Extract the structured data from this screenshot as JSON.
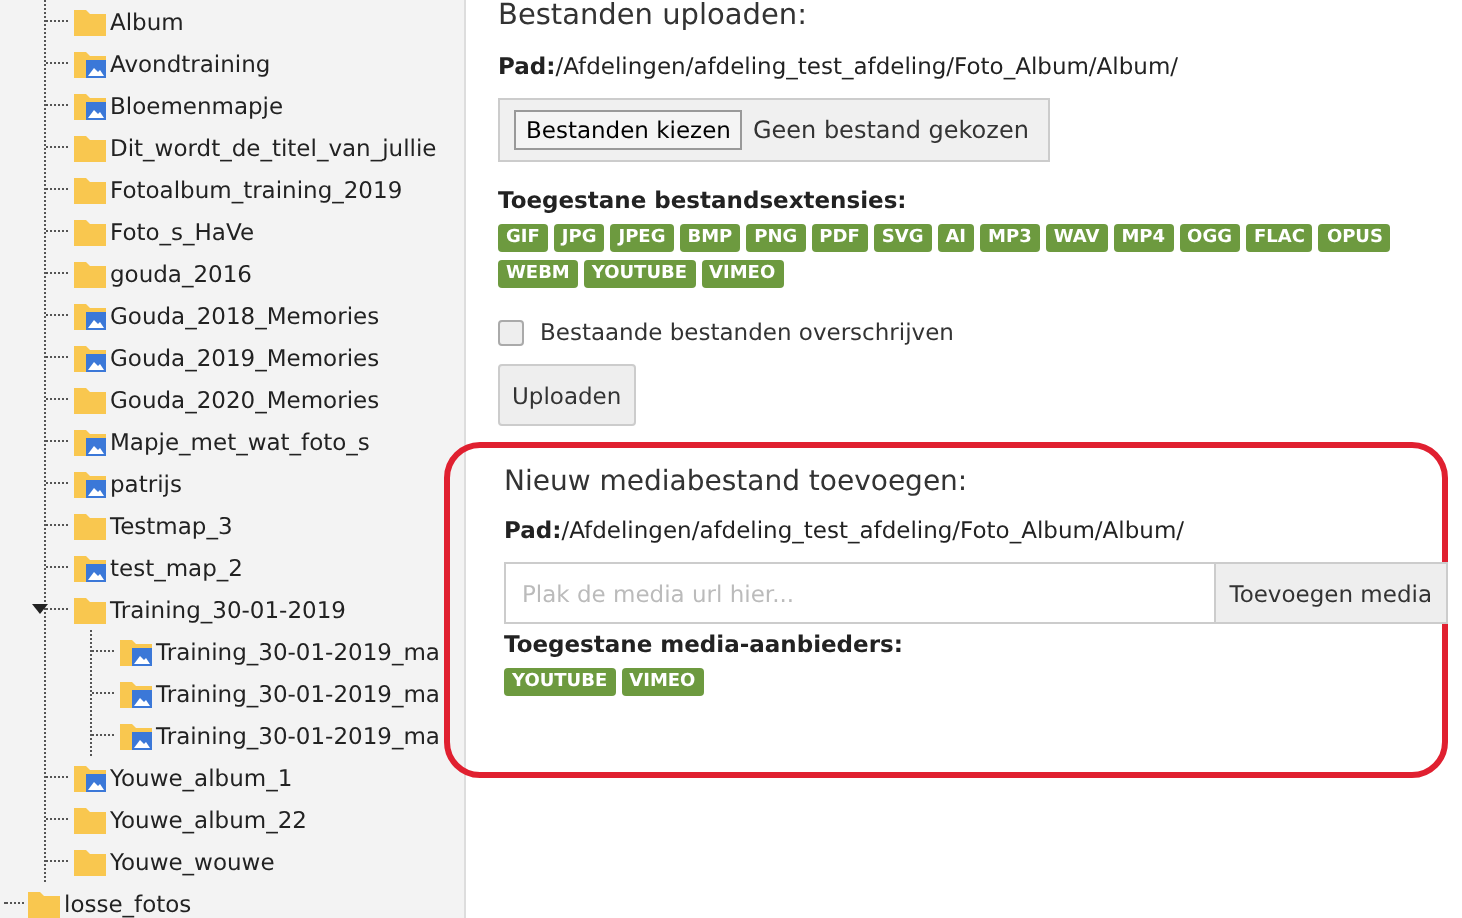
{
  "tree": [
    {
      "children": [
        {
          "label": "Album",
          "kind": "folder"
        },
        {
          "label": "Avondtraining",
          "kind": "photo_folder"
        },
        {
          "label": "Bloemenmapje",
          "kind": "photo_folder"
        },
        {
          "label": "Dit_wordt_de_titel_van_jullie",
          "kind": "folder"
        },
        {
          "label": "Fotoalbum_training_2019",
          "kind": "folder"
        },
        {
          "label": "Foto_s_HaVe",
          "kind": "folder"
        },
        {
          "label": "gouda_2016",
          "kind": "folder"
        },
        {
          "label": "Gouda_2018_Memories",
          "kind": "photo_folder"
        },
        {
          "label": "Gouda_2019_Memories",
          "kind": "photo_folder"
        },
        {
          "label": "Gouda_2020_Memories",
          "kind": "folder"
        },
        {
          "label": "Mapje_met_wat_foto_s",
          "kind": "photo_folder"
        },
        {
          "label": "patrijs",
          "kind": "photo_folder"
        },
        {
          "label": "Testmap_3",
          "kind": "folder"
        },
        {
          "label": "test_map_2",
          "kind": "photo_folder"
        },
        {
          "label": "Training_30-01-2019",
          "kind": "folder",
          "expanded": true,
          "children": [
            {
              "label": "Training_30-01-2019_ma",
              "kind": "photo_folder"
            },
            {
              "label": "Training_30-01-2019_ma",
              "kind": "photo_folder"
            },
            {
              "label": "Training_30-01-2019_ma",
              "kind": "photo_folder"
            }
          ]
        },
        {
          "label": "Youwe_album_1",
          "kind": "photo_folder"
        },
        {
          "label": "Youwe_album_22",
          "kind": "folder"
        },
        {
          "label": "Youwe_wouwe",
          "kind": "folder"
        }
      ]
    },
    {
      "label": "losse_fotos",
      "kind": "folder"
    }
  ],
  "upload": {
    "title": "Bestanden uploaden:",
    "path": "**Pad:**/Afdelingen/afdeling_test_afdeling/Foto_Album/Album/",
    "choose_button": "Bestanden kiezen",
    "file_status": "Geen bestand gekozen",
    "extensions_label": "Toegestane bestandsextensies:",
    "extensions": [
      "GIF",
      "JPG",
      "JPEG",
      "BMP",
      "PNG",
      "PDF",
      "SVG",
      "AI",
      "MP3",
      "WAV",
      "MP4",
      "OGG",
      "FLAC",
      "OPUS",
      "WEBM",
      "YOUTUBE",
      "VIMEO"
    ],
    "overwrite": {
      "label": "Bestaande bestanden overschrijven",
      "checked": false
    },
    "submit": "Uploaden"
  },
  "media": {
    "title": "Nieuw mediabestand toevoegen:",
    "path": "**Pad:**/Afdelingen/afdeling_test_afdeling/Foto_Album/Album/",
    "url_field": {
      "placeholder": "Plak de media url hier..."
    },
    "add_button": "Toevoegen media",
    "providers_label": "Toegestane media-aanbieders:",
    "providers": [
      "YOUTUBE",
      "VIMEO"
    ]
  }
}
